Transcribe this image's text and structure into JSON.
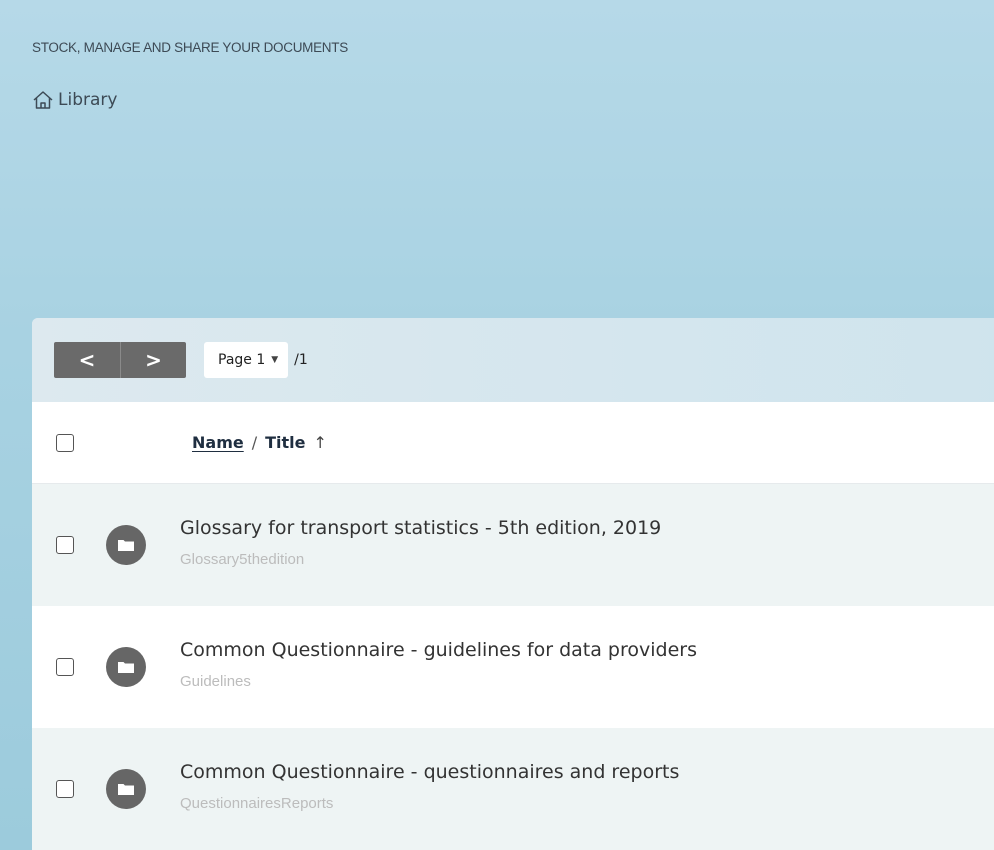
{
  "header": {
    "subtitle": "STOCK, MANAGE AND SHARE YOUR DOCUMENTS",
    "breadcrumb": "Library"
  },
  "toolbar": {
    "prev_label": "<",
    "next_label": ">",
    "page_label": "Page 1",
    "page_total": "/1"
  },
  "table": {
    "col_name": "Name",
    "col_sep": "/",
    "col_title": "Title",
    "sort_arrow": "↑",
    "rows": [
      {
        "title": "Glossary for transport statistics - 5th edition, 2019",
        "name": "Glossary5thedition"
      },
      {
        "title": "Common Questionnaire - guidelines for data providers",
        "name": "Guidelines"
      },
      {
        "title": "Common Questionnaire - questionnaires and reports",
        "name": "QuestionnairesReports"
      }
    ]
  },
  "icons": {
    "home": "home-icon",
    "folder": "folder-icon",
    "caret": "chevron-down-icon"
  }
}
